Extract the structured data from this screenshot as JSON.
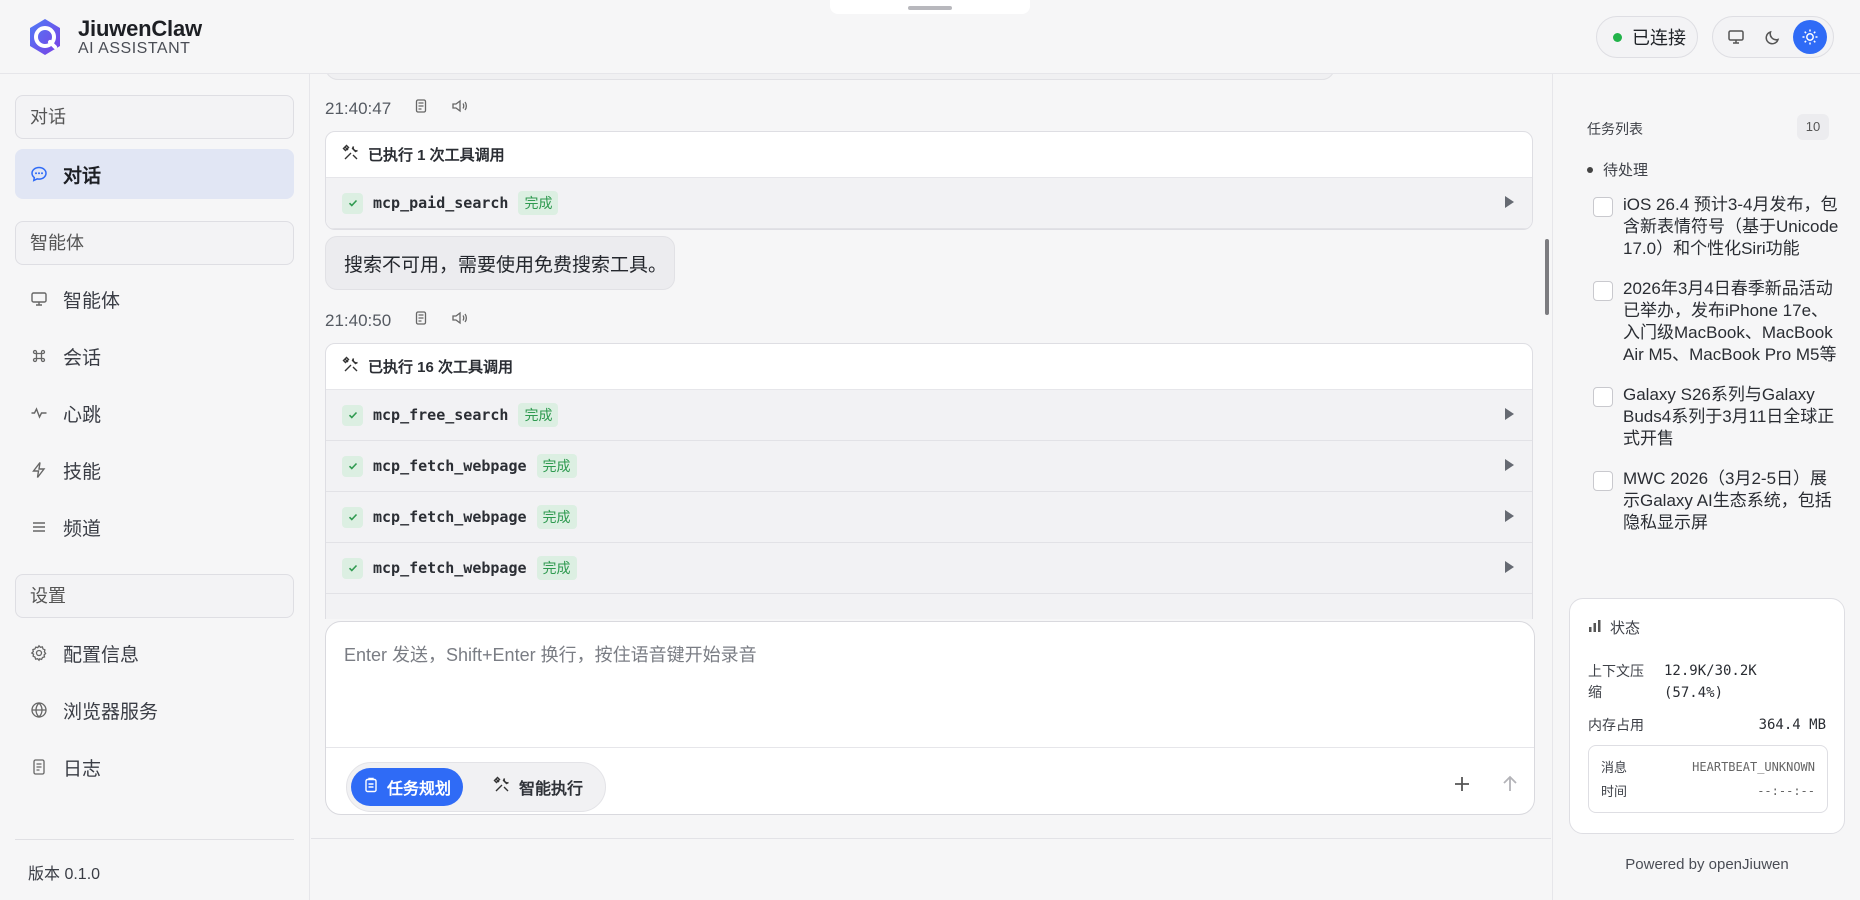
{
  "header": {
    "brand_name": "JiuwenClaw",
    "brand_sub": "AI ASSISTANT",
    "connection_status": "已连接",
    "theme_options": [
      "monitor-icon",
      "moon-icon",
      "sun-icon"
    ],
    "active_theme": "sun-icon"
  },
  "sidebar": {
    "sections": [
      {
        "title": "对话",
        "items": [
          {
            "label": "对话",
            "icon": "chat-bubble-icon",
            "active": true
          }
        ]
      },
      {
        "title": "智能体",
        "items": [
          {
            "label": "智能体",
            "icon": "monitor-icon"
          },
          {
            "label": "会话",
            "icon": "command-icon"
          },
          {
            "label": "心跳",
            "icon": "pulse-icon"
          },
          {
            "label": "技能",
            "icon": "lightning-icon"
          },
          {
            "label": "频道",
            "icon": "list-icon"
          }
        ]
      },
      {
        "title": "设置",
        "items": [
          {
            "label": "配置信息",
            "icon": "gear-icon"
          },
          {
            "label": "浏览器服务",
            "icon": "globe-icon"
          },
          {
            "label": "日志",
            "icon": "document-icon"
          }
        ]
      }
    ],
    "version": "版本 0.1.0"
  },
  "chat": {
    "messages": [
      {
        "time": "21:40:47",
        "tool_summary": "已执行 1 次工具调用",
        "tools": [
          {
            "name": "mcp_paid_search",
            "status": "完成"
          }
        ]
      },
      {
        "text": "搜索不可用，需要使用免费搜索工具。"
      },
      {
        "time": "21:40:50",
        "tool_summary": "已执行 16 次工具调用",
        "tools": [
          {
            "name": "mcp_free_search",
            "status": "完成"
          },
          {
            "name": "mcp_fetch_webpage",
            "status": "完成"
          },
          {
            "name": "mcp_fetch_webpage",
            "status": "完成"
          },
          {
            "name": "mcp_fetch_webpage",
            "status": "完成"
          }
        ]
      }
    ]
  },
  "composer": {
    "placeholder": "Enter 发送，Shift+Enter 换行，按住语音键开始录音",
    "value": "",
    "modes": [
      {
        "label": "任务规划",
        "icon": "clipboard-icon",
        "active": true
      },
      {
        "label": "智能执行",
        "icon": "tools-icon",
        "active": false
      }
    ]
  },
  "right_panel": {
    "task_list_title": "任务列表",
    "task_count": "10",
    "pending_label": "待处理",
    "tasks": [
      "iOS 26.4 预计3-4月发布，包含新表情符号（基于Unicode 17.0）和个性化Siri功能",
      "2026年3月4日春季新品活动已举办，发布iPhone 17e、入门级MacBook、MacBook Air M5、MacBook Pro M5等",
      "Galaxy S26系列与Galaxy Buds4系列于3月11日全球正式开售",
      "MWC 2026（3月2-5日）展示Galaxy AI生态系统，包括隐私显示屏"
    ],
    "status": {
      "title": "状态",
      "context_label": "上下文压缩",
      "context_value": "12.9K/30.2K",
      "context_pct": "(57.4%)",
      "memory_label": "内存占用",
      "memory_value": "364.4 MB",
      "message_label": "消息",
      "message_value": "HEARTBEAT_UNKNOWN",
      "time_label": "时间",
      "time_value": "--:--:--"
    },
    "powered_by": "Powered by openJiuwen"
  },
  "colors": {
    "accent": "#2f6bf6",
    "success": "#22b34a",
    "done_badge_bg": "#dcefe2",
    "done_badge_text": "#2f9a50",
    "active_nav_bg": "#e1e6f4"
  }
}
